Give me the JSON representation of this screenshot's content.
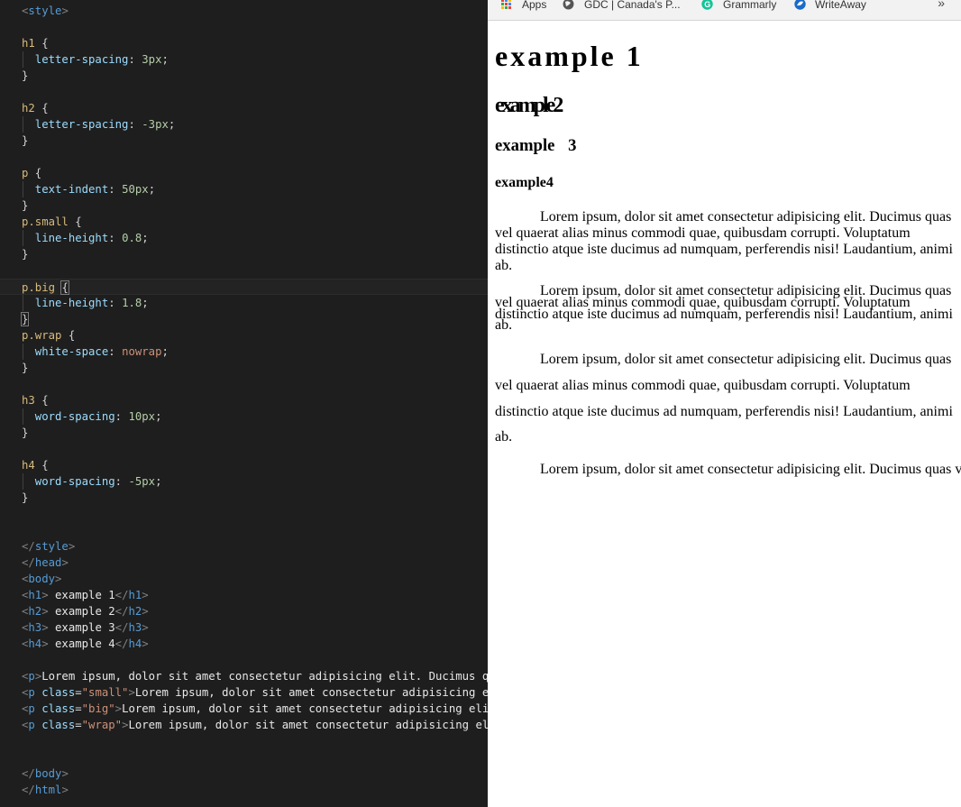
{
  "editor": {
    "lines": [
      [
        [
          "t-br",
          "<"
        ],
        [
          "t-tag",
          "style"
        ],
        [
          "t-br",
          ">"
        ]
      ],
      [],
      [
        [
          "t-sel",
          "h1"
        ],
        [
          "t-pun",
          " {"
        ]
      ],
      [
        [
          "t-prop",
          "  letter-spacing"
        ],
        [
          "t-pun",
          ": "
        ],
        [
          "t-num",
          "3px"
        ],
        [
          "t-pun",
          ";"
        ]
      ],
      [
        [
          "t-pun",
          "}"
        ]
      ],
      [],
      [
        [
          "t-sel",
          "h2"
        ],
        [
          "t-pun",
          " {"
        ]
      ],
      [
        [
          "t-prop",
          "  letter-spacing"
        ],
        [
          "t-pun",
          ": "
        ],
        [
          "t-num",
          "-3px"
        ],
        [
          "t-pun",
          ";"
        ]
      ],
      [
        [
          "t-pun",
          "}"
        ]
      ],
      [],
      [
        [
          "t-sel",
          "p"
        ],
        [
          "t-pun",
          " {"
        ]
      ],
      [
        [
          "t-prop",
          "  text-indent"
        ],
        [
          "t-pun",
          ": "
        ],
        [
          "t-num",
          "50px"
        ],
        [
          "t-pun",
          ";"
        ]
      ],
      [
        [
          "t-pun",
          "}"
        ]
      ],
      [
        [
          "t-sel",
          "p.small"
        ],
        [
          "t-pun",
          " {"
        ]
      ],
      [
        [
          "t-prop",
          "  line-height"
        ],
        [
          "t-pun",
          ": "
        ],
        [
          "t-num",
          "0.8"
        ],
        [
          "t-pun",
          ";"
        ]
      ],
      [
        [
          "t-pun",
          "}"
        ]
      ],
      [],
      [
        [
          "t-sel",
          "p.big"
        ],
        [
          "t-pun",
          " "
        ],
        [
          "t-pun brace-box",
          "{"
        ]
      ],
      [
        [
          "t-prop",
          "  line-height"
        ],
        [
          "t-pun",
          ": "
        ],
        [
          "t-num",
          "1.8"
        ],
        [
          "t-pun",
          ";"
        ]
      ],
      [
        [
          "t-pun brace-box",
          "}"
        ]
      ],
      [
        [
          "t-sel",
          "p.wrap"
        ],
        [
          "t-pun",
          " {"
        ]
      ],
      [
        [
          "t-prop",
          "  white-space"
        ],
        [
          "t-pun",
          ": "
        ],
        [
          "t-kw",
          "nowrap"
        ],
        [
          "t-pun",
          ";"
        ]
      ],
      [
        [
          "t-pun",
          "}"
        ]
      ],
      [],
      [
        [
          "t-sel",
          "h3"
        ],
        [
          "t-pun",
          " {"
        ]
      ],
      [
        [
          "t-prop",
          "  word-spacing"
        ],
        [
          "t-pun",
          ": "
        ],
        [
          "t-num",
          "10px"
        ],
        [
          "t-pun",
          ";"
        ]
      ],
      [
        [
          "t-pun",
          "}"
        ]
      ],
      [],
      [
        [
          "t-sel",
          "h4"
        ],
        [
          "t-pun",
          " {"
        ]
      ],
      [
        [
          "t-prop",
          "  word-spacing"
        ],
        [
          "t-pun",
          ": "
        ],
        [
          "t-num",
          "-5px"
        ],
        [
          "t-pun",
          ";"
        ]
      ],
      [
        [
          "t-pun",
          "}"
        ]
      ],
      [],
      [],
      [
        [
          "t-br",
          "</"
        ],
        [
          "t-tag",
          "style"
        ],
        [
          "t-br",
          ">"
        ]
      ],
      [
        [
          "t-br",
          "</"
        ],
        [
          "t-tag",
          "head"
        ],
        [
          "t-br",
          ">"
        ]
      ],
      [
        [
          "t-br",
          "<"
        ],
        [
          "t-tag",
          "body"
        ],
        [
          "t-br",
          ">"
        ]
      ],
      [
        [
          "t-br",
          "<"
        ],
        [
          "t-tag",
          "h1"
        ],
        [
          "t-br",
          ">"
        ],
        [
          "t-txt",
          " example 1"
        ],
        [
          "t-br",
          "</"
        ],
        [
          "t-tag",
          "h1"
        ],
        [
          "t-br",
          ">"
        ]
      ],
      [
        [
          "t-br",
          "<"
        ],
        [
          "t-tag",
          "h2"
        ],
        [
          "t-br",
          ">"
        ],
        [
          "t-txt",
          " example 2"
        ],
        [
          "t-br",
          "</"
        ],
        [
          "t-tag",
          "h2"
        ],
        [
          "t-br",
          ">"
        ]
      ],
      [
        [
          "t-br",
          "<"
        ],
        [
          "t-tag",
          "h3"
        ],
        [
          "t-br",
          ">"
        ],
        [
          "t-txt",
          " example 3"
        ],
        [
          "t-br",
          "</"
        ],
        [
          "t-tag",
          "h3"
        ],
        [
          "t-br",
          ">"
        ]
      ],
      [
        [
          "t-br",
          "<"
        ],
        [
          "t-tag",
          "h4"
        ],
        [
          "t-br",
          ">"
        ],
        [
          "t-txt",
          " example 4"
        ],
        [
          "t-br",
          "</"
        ],
        [
          "t-tag",
          "h4"
        ],
        [
          "t-br",
          ">"
        ]
      ],
      [],
      [
        [
          "t-br",
          "<"
        ],
        [
          "t-tag",
          "p"
        ],
        [
          "t-br",
          ">"
        ],
        [
          "t-txt",
          "Lorem ipsum, dolor sit amet consectetur adipisicing elit. Ducimus quas"
        ]
      ],
      [
        [
          "t-br",
          "<"
        ],
        [
          "t-tag",
          "p"
        ],
        [
          "t-attr",
          " class"
        ],
        [
          "t-pun",
          "="
        ],
        [
          "t-str",
          "\"small\""
        ],
        [
          "t-br",
          ">"
        ],
        [
          "t-txt",
          "Lorem ipsum, dolor sit amet consectetur adipisicing elit."
        ]
      ],
      [
        [
          "t-br",
          "<"
        ],
        [
          "t-tag",
          "p"
        ],
        [
          "t-attr",
          " class"
        ],
        [
          "t-pun",
          "="
        ],
        [
          "t-str",
          "\"big\""
        ],
        [
          "t-br",
          ">"
        ],
        [
          "t-txt",
          "Lorem ipsum, dolor sit amet consectetur adipisicing elit."
        ]
      ],
      [
        [
          "t-br",
          "<"
        ],
        [
          "t-tag",
          "p"
        ],
        [
          "t-attr",
          " class"
        ],
        [
          "t-pun",
          "="
        ],
        [
          "t-str",
          "\"wrap\""
        ],
        [
          "t-br",
          ">"
        ],
        [
          "t-txt",
          "Lorem ipsum, dolor sit amet consectetur adipisicing elit."
        ]
      ],
      [],
      [],
      [
        [
          "t-br",
          "</"
        ],
        [
          "t-tag",
          "body"
        ],
        [
          "t-br",
          ">"
        ]
      ],
      [
        [
          "t-br",
          "</"
        ],
        [
          "t-tag",
          "html"
        ],
        [
          "t-br",
          ">"
        ]
      ]
    ]
  },
  "bookmarks": {
    "apps": "Apps",
    "gdc": "GDC | Canada's P...",
    "grammarly": "Grammarly",
    "writeaway": "WriteAway",
    "more": "»"
  },
  "page": {
    "h1": "example 1",
    "h2": "example2",
    "h3": "example 3",
    "h4": "example4",
    "p1": "Lorem ipsum, dolor sit amet consectetur adipisicing elit. Ducimus quas vel quaerat alias minus commodi quae, quibusdam corrupti. Voluptatum distinctio atque iste ducimus ad numquam, perferendis nisi! Laudantium, animi ab.",
    "p_small": "Lorem ipsum, dolor sit amet consectetur adipisicing elit. Ducimus quas vel quaerat alias minus commodi quae, quibusdam corrupti. Voluptatum distinctio atque iste ducimus ad numquam, perferendis nisi! Laudantium, animi ab.",
    "p_big": "Lorem ipsum, dolor sit amet consectetur adipisicing elit. Ducimus quas vel quaerat alias minus commodi quae, quibusdam corrupti. Voluptatum distinctio atque iste ducimus ad numquam, perferendis nisi! Laudantium, animi ab.",
    "p_wrap": "Lorem ipsum, dolor sit amet consectetur adipisicing elit. Ducimus quas vel quaerat alias minus commodi quae, quibusdam corrupti."
  },
  "colors": {
    "editor_bg": "#1e1e1e",
    "tag": "#569cd6",
    "selector": "#d7ba7d",
    "property": "#9cdcfe",
    "number": "#b5cea8",
    "string": "#ce9178"
  }
}
